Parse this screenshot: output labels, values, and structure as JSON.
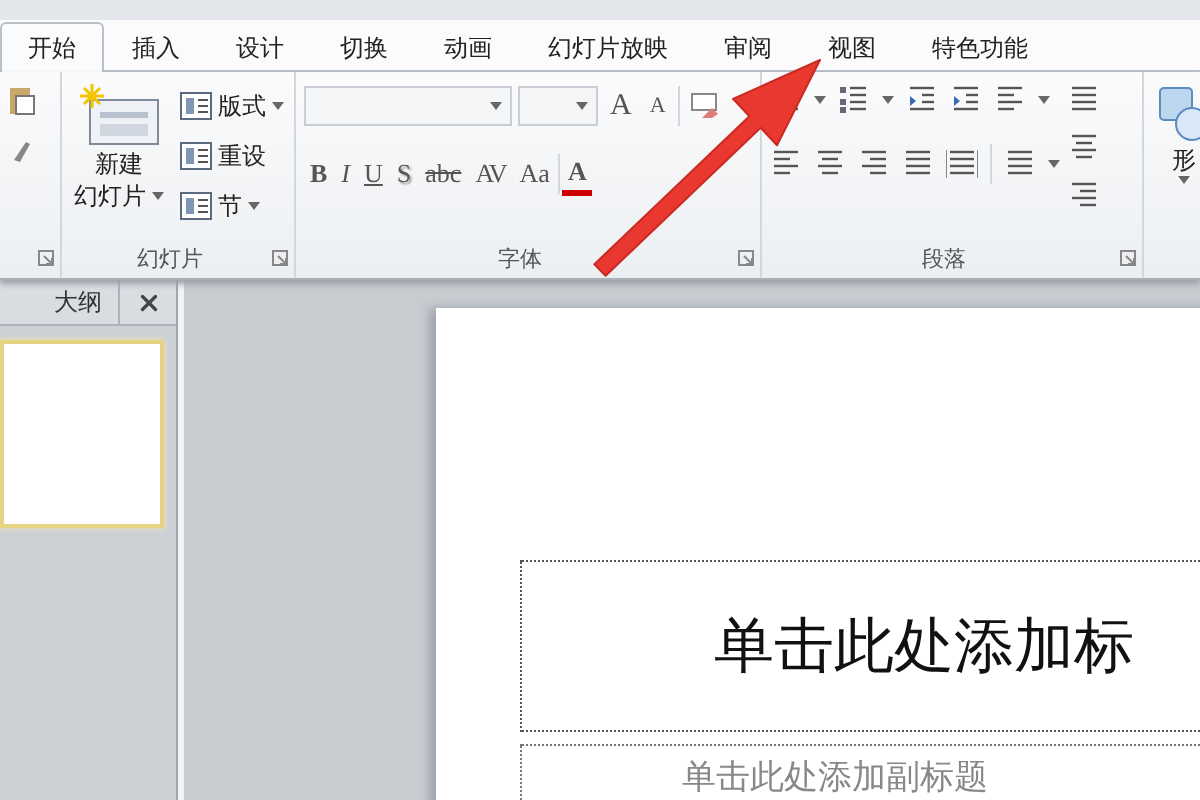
{
  "tabs": [
    {
      "label": "开始",
      "selected": true
    },
    {
      "label": "插入",
      "selected": false
    },
    {
      "label": "设计",
      "selected": false
    },
    {
      "label": "切换",
      "selected": false
    },
    {
      "label": "动画",
      "selected": false
    },
    {
      "label": "幻灯片放映",
      "selected": false
    },
    {
      "label": "审阅",
      "selected": false
    },
    {
      "label": "视图",
      "selected": false
    },
    {
      "label": "特色功能",
      "selected": false
    }
  ],
  "ribbon": {
    "slides_group": {
      "label": "幻灯片",
      "new_slide": [
        "新建",
        "幻灯片"
      ],
      "small_buttons": [
        {
          "label": "版式",
          "dropdown": true
        },
        {
          "label": "重设",
          "dropdown": false
        },
        {
          "label": "节",
          "dropdown": true
        }
      ]
    },
    "font_group": {
      "label": "字体",
      "format_buttons": [
        "B",
        "I",
        "U",
        "S",
        "abc",
        "AV",
        "Aa"
      ],
      "grow_shrink": [
        "A",
        "A"
      ],
      "font_color": "A"
    },
    "paragraph_group": {
      "label": "段落"
    },
    "shapes_group": {
      "label": "形"
    }
  },
  "outline_pane": {
    "tab": "大纲"
  },
  "slide": {
    "title_placeholder": "单击此处添加标",
    "subtitle_placeholder": "单击此处添加副标题"
  }
}
